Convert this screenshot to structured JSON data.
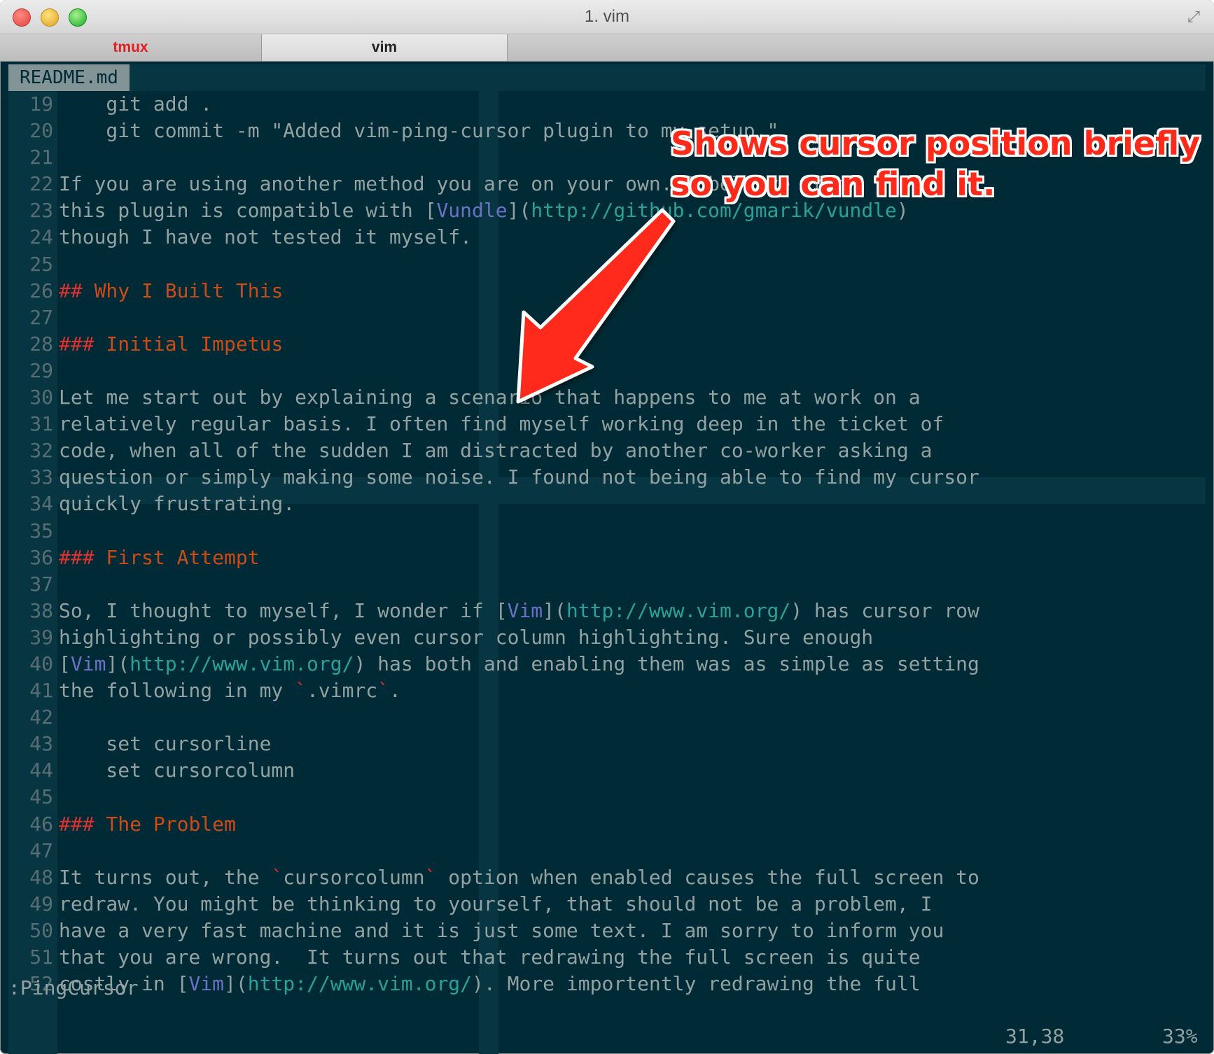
{
  "window": {
    "title": "1. vim",
    "fullscreen_glyph": "⤢"
  },
  "tabs": [
    {
      "label": "tmux"
    },
    {
      "label": "vim"
    }
  ],
  "buffer": {
    "name": "README.md"
  },
  "lines": [
    {
      "n": "19",
      "segs": [
        {
          "t": "    git add ."
        }
      ]
    },
    {
      "n": "20",
      "segs": [
        {
          "t": "    git commit -m \"Added vim-ping-cursor plugin to my setup.\""
        }
      ]
    },
    {
      "n": "21",
      "segs": []
    },
    {
      "n": "22",
      "segs": [
        {
          "t": "If you are using another method you are on your own. I believe that"
        }
      ]
    },
    {
      "n": "23",
      "segs": [
        {
          "t": "this plugin is compatible with ["
        },
        {
          "t": "Vundle",
          "c": "lk"
        },
        {
          "t": "]("
        },
        {
          "t": "http://github.com/gmarik/vundle",
          "c": "url"
        },
        {
          "t": ")"
        }
      ]
    },
    {
      "n": "24",
      "segs": [
        {
          "t": "though I have not tested it myself."
        }
      ]
    },
    {
      "n": "25",
      "segs": []
    },
    {
      "n": "26",
      "segs": [
        {
          "t": "##",
          "c": "mk"
        },
        {
          "t": " Why I Built This",
          "c": "hd"
        }
      ]
    },
    {
      "n": "27",
      "segs": []
    },
    {
      "n": "28",
      "segs": [
        {
          "t": "###",
          "c": "mk"
        },
        {
          "t": " Initial Impetus",
          "c": "hd"
        }
      ]
    },
    {
      "n": "29",
      "segs": []
    },
    {
      "n": "30",
      "segs": [
        {
          "t": "Let me start out by explaining a scenario that happens to me at work on a"
        }
      ]
    },
    {
      "n": "31",
      "segs": [
        {
          "t": "relatively regular basis. I often find myself working deep in the ticket of"
        }
      ]
    },
    {
      "n": "32",
      "segs": [
        {
          "t": "code, when all of the sudden I am distracted by another co-worker asking a"
        }
      ]
    },
    {
      "n": "33",
      "segs": [
        {
          "t": "question or simply making some noise. I found not being able to find my cursor"
        }
      ]
    },
    {
      "n": "34",
      "segs": [
        {
          "t": "quickly frustrating."
        }
      ]
    },
    {
      "n": "35",
      "segs": []
    },
    {
      "n": "36",
      "segs": [
        {
          "t": "###",
          "c": "mk"
        },
        {
          "t": " First Attempt",
          "c": "hd"
        }
      ]
    },
    {
      "n": "37",
      "segs": []
    },
    {
      "n": "38",
      "segs": [
        {
          "t": "So, I thought to myself, I wonder if ["
        },
        {
          "t": "Vim",
          "c": "lk"
        },
        {
          "t": "]("
        },
        {
          "t": "http://www.vim.org/",
          "c": "url"
        },
        {
          "t": ") has cursor row"
        }
      ]
    },
    {
      "n": "39",
      "segs": [
        {
          "t": "highlighting or possibly even cursor column highlighting. Sure enough"
        }
      ]
    },
    {
      "n": "40",
      "segs": [
        {
          "t": "["
        },
        {
          "t": "Vim",
          "c": "lk"
        },
        {
          "t": "]("
        },
        {
          "t": "http://www.vim.org/",
          "c": "url"
        },
        {
          "t": ") has both and enabling them was as simple as setting"
        }
      ]
    },
    {
      "n": "41",
      "segs": [
        {
          "t": "the following in my "
        },
        {
          "t": "`",
          "c": "bt"
        },
        {
          "t": ".vimrc"
        },
        {
          "t": "`",
          "c": "bt"
        },
        {
          "t": "."
        }
      ]
    },
    {
      "n": "42",
      "segs": []
    },
    {
      "n": "43",
      "segs": [
        {
          "t": "    set cursorline"
        }
      ]
    },
    {
      "n": "44",
      "segs": [
        {
          "t": "    set cursorcolumn"
        }
      ]
    },
    {
      "n": "45",
      "segs": []
    },
    {
      "n": "46",
      "segs": [
        {
          "t": "###",
          "c": "mk"
        },
        {
          "t": " The Problem",
          "c": "hd"
        }
      ]
    },
    {
      "n": "47",
      "segs": []
    },
    {
      "n": "48",
      "segs": [
        {
          "t": "It turns out, the "
        },
        {
          "t": "`",
          "c": "bt"
        },
        {
          "t": "cursorcolumn"
        },
        {
          "t": "`",
          "c": "bt"
        },
        {
          "t": " option when enabled causes the full screen to"
        }
      ]
    },
    {
      "n": "49",
      "segs": [
        {
          "t": "redraw. You might be thinking to yourself, that should not be a problem, I"
        }
      ]
    },
    {
      "n": "50",
      "segs": [
        {
          "t": "have a very fast machine and it is just some text. I am sorry to inform you"
        }
      ]
    },
    {
      "n": "51",
      "segs": [
        {
          "t": "that you are wrong.  It turns out that redrawing the full screen is quite"
        }
      ]
    },
    {
      "n": "52",
      "segs": [
        {
          "t": "costly in ["
        },
        {
          "t": "Vim",
          "c": "lk"
        },
        {
          "t": "]("
        },
        {
          "t": "http://www.vim.org/",
          "c": "url"
        },
        {
          "t": "). More importently redrawing the full"
        }
      ]
    }
  ],
  "command_line": ":PingCursor",
  "status": {
    "ruler": "31,38",
    "percent": "33%"
  },
  "annotation": {
    "line1": "Shows cursor position briefly",
    "line2": "so you can find it."
  },
  "colors": {
    "background": "#002b36",
    "highlight": "#073642",
    "annotation_red": "#ff2a1a"
  }
}
